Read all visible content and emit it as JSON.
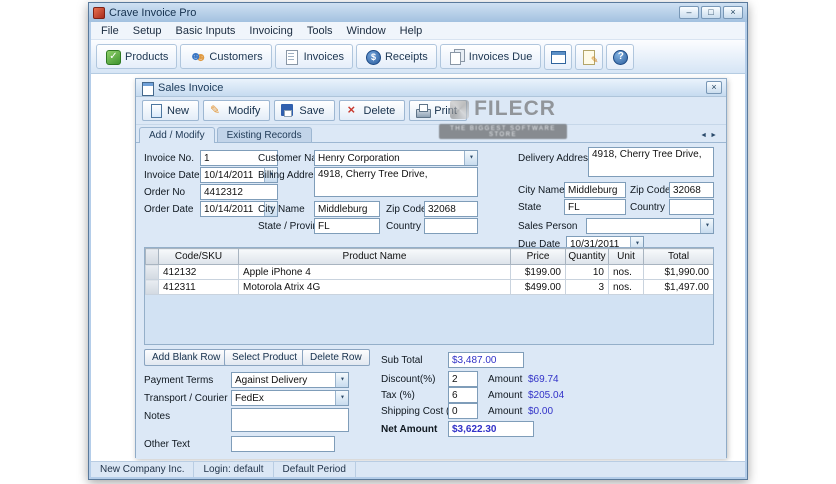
{
  "window": {
    "title": "Crave Invoice Pro"
  },
  "icons": {
    "minimize-icon": "–",
    "maximize-icon": "□",
    "close-icon": "×",
    "tab-scroll-left-icon": "◄",
    "tab-scroll-right-icon": "►"
  },
  "menu": {
    "items": [
      "File",
      "Setup",
      "Basic Inputs",
      "Invoicing",
      "Tools",
      "Window",
      "Help"
    ]
  },
  "toolbar": {
    "buttons": [
      {
        "label": "Products",
        "icon": "products-icon"
      },
      {
        "label": "Customers",
        "icon": "customers-icon"
      },
      {
        "label": "Invoices",
        "icon": "invoices-icon"
      },
      {
        "label": "Receipts",
        "icon": "receipts-icon"
      },
      {
        "label": "Invoices Due",
        "icon": "invoices-due-icon"
      }
    ],
    "icon_buttons": [
      "grid-view-icon",
      "memo-icon",
      "help-icon"
    ]
  },
  "sales_invoice": {
    "title": "Sales Invoice",
    "toolbar_buttons": [
      "New",
      "Modify",
      "Save",
      "Delete",
      "Print"
    ],
    "tabs": [
      {
        "label": "Add / Modify",
        "active": true
      },
      {
        "label": "Existing Records",
        "active": false
      }
    ],
    "form": {
      "invoice_no": {
        "label": "Invoice No.",
        "value": "1"
      },
      "invoice_date": {
        "label": "Invoice Date",
        "value": "10/14/2011"
      },
      "order_no": {
        "label": "Order No",
        "value": "4412312"
      },
      "order_date": {
        "label": "Order Date",
        "value": "10/14/2011"
      },
      "customer_name": {
        "label": "Customer Name",
        "value": "Henry Corporation"
      },
      "billing_address": {
        "label": "Billing Address",
        "value": "4918, Cherry Tree Drive,"
      },
      "billing_city": {
        "label": "City Name",
        "value": "Middleburg"
      },
      "billing_zip": {
        "label": "Zip Code",
        "value": "32068"
      },
      "billing_state": {
        "label": "State / Province",
        "value": "FL"
      },
      "billing_country": {
        "label": "Country",
        "value": ""
      },
      "delivery_address": {
        "label": "Delivery Address",
        "value": "4918, Cherry Tree Drive,"
      },
      "delivery_city": {
        "label": "City Name",
        "value": "Middleburg"
      },
      "delivery_zip": {
        "label": "Zip Code",
        "value": "32068"
      },
      "delivery_state": {
        "label": "State",
        "value": "FL"
      },
      "delivery_country": {
        "label": "Country",
        "value": ""
      },
      "sales_person": {
        "label": "Sales Person",
        "value": ""
      },
      "due_date": {
        "label": "Due Date",
        "value": "10/31/2011"
      }
    },
    "items_table": {
      "columns": [
        "Code/SKU",
        "Product Name",
        "Price",
        "Quantity",
        "Unit",
        "Total"
      ],
      "rows": [
        [
          "412132",
          "Apple iPhone 4",
          "$199.00",
          "10",
          "nos.",
          "$1,990.00"
        ],
        [
          "412311",
          "Motorola Atrix 4G",
          "$499.00",
          "3",
          "nos.",
          "$1,497.00"
        ]
      ]
    },
    "row_buttons": [
      "Add Blank Row",
      "Select Product",
      "Delete Row"
    ],
    "details": {
      "payment_terms": {
        "label": "Payment Terms",
        "value": "Against Delivery"
      },
      "transport": {
        "label": "Transport / Courier",
        "value": "FedEx"
      },
      "notes": {
        "label": "Notes",
        "value": ""
      },
      "other_text": {
        "label": "Other Text",
        "value": ""
      }
    },
    "totals": {
      "sub_total": {
        "label": "Sub Total",
        "value": "$3,487.00"
      },
      "discount": {
        "label": "Discount(%)",
        "pct": "2",
        "amount_label": "Amount",
        "amount": "$69.74"
      },
      "tax": {
        "label": "Tax (%)",
        "pct": "6",
        "amount_label": "Amount",
        "amount": "$205.04"
      },
      "shipping": {
        "label": "Shipping Cost (%)",
        "pct": "0",
        "amount_label": "Amount",
        "amount": "$0.00"
      },
      "net_amount": {
        "label": "Net Amount",
        "value": "$3,622.30"
      }
    }
  },
  "status_bar": {
    "company": "New Company Inc.",
    "login": "Login: default",
    "period": "Default Period"
  },
  "watermark": {
    "title": "FILECR",
    "subtitle": "THE BIGGEST SOFTWARE STORE"
  },
  "colors": {
    "titlebar": "#a3c1e0",
    "form_bg": "#dce8f6",
    "accent_blue": "#2d5f9e",
    "amount_text": "#3232c8",
    "watermark_gray": "#8c8c8c"
  }
}
